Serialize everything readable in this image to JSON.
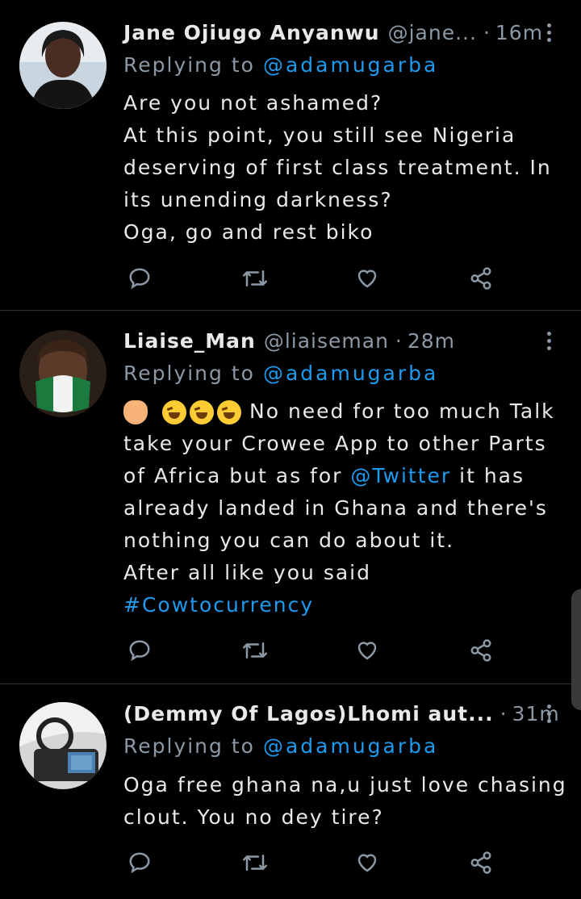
{
  "tweets": [
    {
      "name": "Jane Ojiugo Anyanwu",
      "handle": "@jane...",
      "dot": "·",
      "time": "16m",
      "replying_label": "Replying to",
      "replying_to": "@adamugarba",
      "lines": [
        "Are you not ashamed?",
        "At this point, you still see Nigeria",
        "deserving of first class treatment. In",
        "its unending darkness?",
        "Oga, go and rest biko"
      ]
    },
    {
      "name": "Liaise_Man",
      "handle": "@liaiseman",
      "dot": "·",
      "time": "28m",
      "replying_label": "Replying to",
      "replying_to": "@adamugarba",
      "emoji_names": [
        "person-facepalming-emoji",
        "rolling-laughing-emoji",
        "rolling-laughing-emoji",
        "rolling-laughing-emoji"
      ],
      "line1": "No need for too much Talk",
      "line2": "take your Crowee App to other Parts",
      "line3_pre": "of Africa but as for ",
      "line3_link": "@Twitter",
      "line3_post": " it has",
      "line4": "already landed in Ghana and there's",
      "line5": "nothing you can do about it.",
      "line6": "After all like you said",
      "hashtag": "#Cowtocurrency"
    },
    {
      "name": "(Demmy Of Lagos)Lhomi aut...",
      "handle": "",
      "dot": "·",
      "time": "31m",
      "replying_label": "Replying to",
      "replying_to": "@adamugarba",
      "lines": [
        "Oga free ghana na,u just love chasing",
        "clout. You no dey tire?"
      ]
    }
  ],
  "colors": {
    "background": "#000000",
    "text": "#e7e9ea",
    "secondary": "#8b98a5",
    "link": "#1d9bf0",
    "divider": "#2f3336"
  },
  "icons": [
    "reply-icon",
    "retweet-icon",
    "like-icon",
    "share-icon",
    "more-options-icon"
  ]
}
